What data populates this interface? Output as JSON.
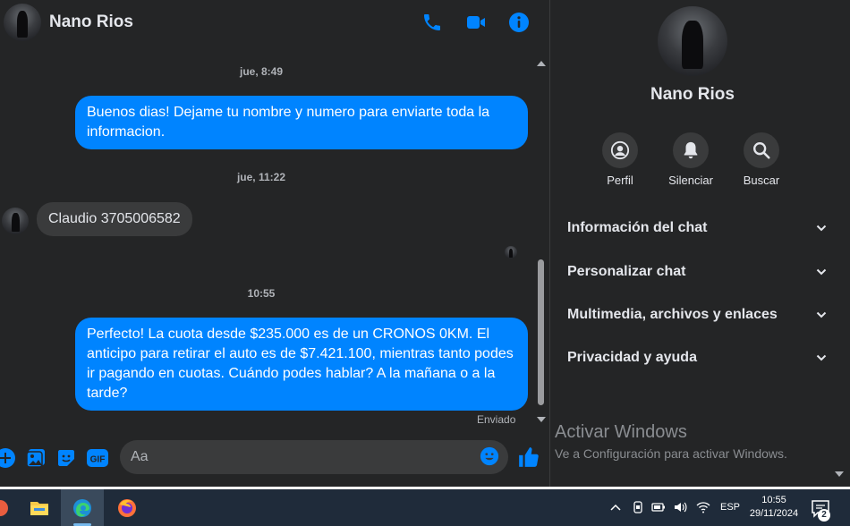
{
  "contact": {
    "name": "Nano Rios"
  },
  "header": {
    "actions": [
      "phone-icon",
      "video-call-icon",
      "info-icon"
    ]
  },
  "messages": [
    {
      "kind": "timestamp",
      "text": "jue, 8:49"
    },
    {
      "kind": "outgoing",
      "text": "Buenos dias! Dejame tu nombre y numero para enviarte toda la informacion."
    },
    {
      "kind": "timestamp",
      "text": "jue, 11:22"
    },
    {
      "kind": "incoming",
      "text": "Claudio 3705006582"
    },
    {
      "kind": "timestamp",
      "text": "10:55"
    },
    {
      "kind": "outgoing",
      "text": "Perfecto! La cuota desde $235.000 es de un CRONOS 0KM. El anticipo para retirar el auto es de $7.421.100, mientras tanto podes ir pagando en cuotas. Cuándo podes hablar? A la mañana o a la tarde?"
    }
  ],
  "status": {
    "sent": "Enviado"
  },
  "composer": {
    "placeholder": "Aa",
    "icons": [
      "plus-icon",
      "image-icon",
      "sticker-icon",
      "gif-icon",
      "emoji-icon",
      "like-icon"
    ],
    "gif_label": "GIF"
  },
  "sidebar": {
    "name": "Nano Rios",
    "actions": [
      {
        "label": "Perfil",
        "icon": "profile-icon"
      },
      {
        "label": "Silenciar",
        "icon": "bell-icon"
      },
      {
        "label": "Buscar",
        "icon": "search-icon"
      }
    ],
    "sections": [
      "Información del chat",
      "Personalizar chat",
      "Multimedia, archivos y enlaces",
      "Privacidad y ayuda"
    ]
  },
  "watermark": {
    "title": "Activar Windows",
    "subtitle": "Ve a Configuración para activar Windows."
  },
  "taskbar": {
    "apps": [
      "app-icon",
      "file-explorer-icon",
      "edge-icon",
      "firefox-icon"
    ],
    "language": "ESP",
    "time": "10:55",
    "date": "29/11/2024",
    "notifications": "2"
  },
  "colors": {
    "accent": "#0084ff",
    "background": "#242526",
    "bubble_incoming": "#3a3b3c",
    "taskbar": "#1f2b3a"
  }
}
